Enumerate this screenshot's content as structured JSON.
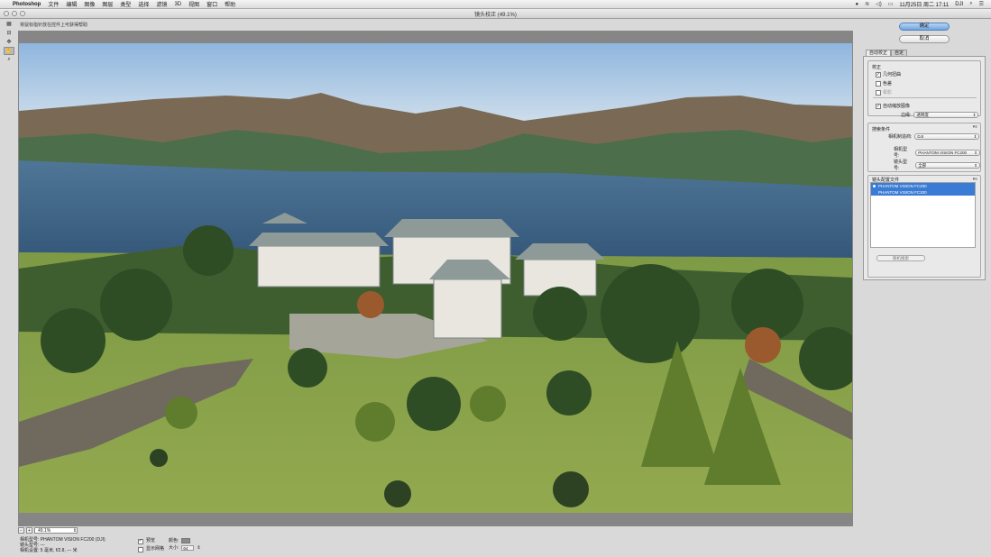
{
  "menubar": {
    "app_name": "Photoshop",
    "menus": [
      "文件",
      "编辑",
      "图像",
      "图层",
      "类型",
      "选择",
      "滤镜",
      "3D",
      "视图",
      "窗口",
      "帮助"
    ],
    "clock": "11月25日 周二 17:11",
    "user": "DJI"
  },
  "window": {
    "title": "镜头校正 (49.1%)"
  },
  "hint": "将鼠标指针放在控件上可获得帮助",
  "zoom": {
    "value": "49.1%"
  },
  "info": {
    "camera": "相机型号: PHANTOM VISION FC200 (DJI)",
    "lens": "镜头型号: ---",
    "settings": "相机设置: 5 毫米, f/2.8, --- 米"
  },
  "options": {
    "preview_label": "预览",
    "preview_checked": true,
    "grid_label": "显示网格",
    "grid_checked": false,
    "color_label": "颜色:",
    "size_label": "大小:",
    "size_value": "64"
  },
  "buttons": {
    "ok": "确定",
    "cancel": "取消"
  },
  "tabs": [
    "自动校正",
    "自定"
  ],
  "correction": {
    "legend": "校正",
    "geometric": "几何扭曲",
    "chromatic": "色差",
    "vignette": "晕影",
    "auto_scale": "自动缩放图像",
    "edge_label": "边缘:",
    "edge_value": "透明度"
  },
  "search": {
    "legend": "搜索条件",
    "make_label": "相机制造商:",
    "make_value": "DJI",
    "model_label": "相机型号:",
    "model_value": "PHANTOM VISION FC200",
    "lens_label": "镜头型号:",
    "lens_value": "全部"
  },
  "profiles": {
    "legend": "镜头配置文件",
    "items": [
      "PHANTOM VISION FC200",
      "PHANTOM VISION FC200"
    ],
    "online_button": "联机搜索"
  }
}
